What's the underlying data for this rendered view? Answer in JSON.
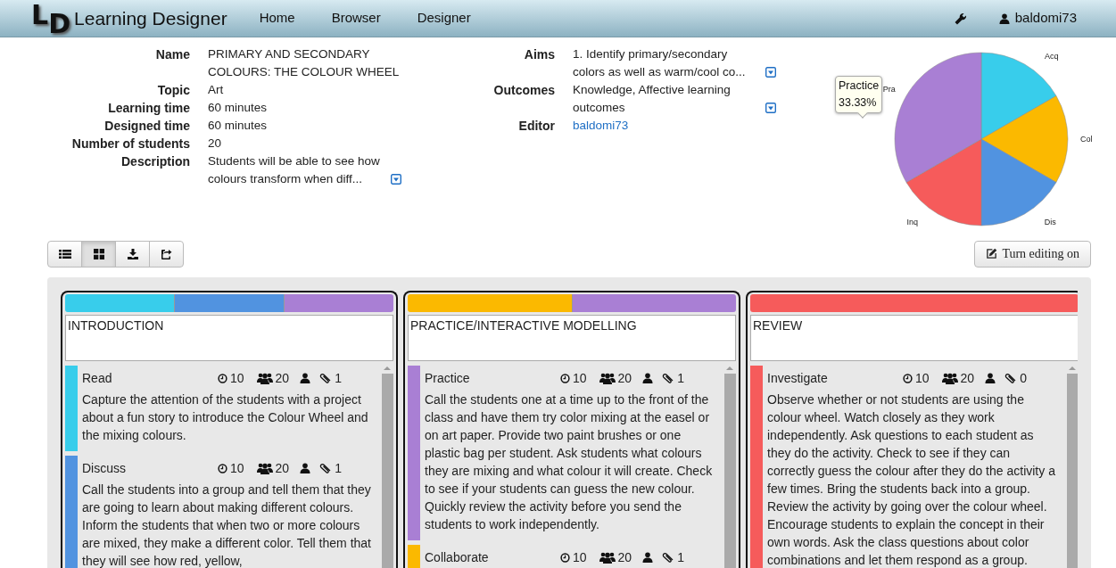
{
  "header": {
    "logo": [
      "L",
      "D"
    ],
    "title": "Learning Designer",
    "nav": [
      {
        "label": "Home"
      },
      {
        "label": "Browser"
      },
      {
        "label": "Designer"
      }
    ],
    "user": "baldomi73"
  },
  "details": {
    "left": [
      {
        "label": "Name",
        "value": "PRIMARY AND SECONDARY COLOURS: THE COLOUR WHEEL",
        "kind": "text",
        "truncated": false
      },
      {
        "label": "Topic",
        "value": "Art",
        "kind": "text",
        "truncated": false
      },
      {
        "label": "Learning time",
        "value": "60 minutes",
        "kind": "text",
        "truncated": false
      },
      {
        "label": "Designed time",
        "value": "60 minutes",
        "kind": "text",
        "truncated": false
      },
      {
        "label": "Number of students",
        "value": "20",
        "kind": "text",
        "truncated": false
      },
      {
        "label": "Description",
        "value": "Students will be able to see how colours transform when diff...",
        "kind": "text",
        "truncated": true
      }
    ],
    "right": [
      {
        "label": "Aims",
        "value": "1. Identify primary/secondary colors as well as warm/cool co...",
        "kind": "text",
        "truncated": true
      },
      {
        "label": "Outcomes",
        "value": "Knowledge, Affective learning outcomes",
        "kind": "text",
        "truncated": true
      },
      {
        "label": "Editor",
        "value": "baldomi73",
        "kind": "link",
        "truncated": false
      }
    ]
  },
  "pie": {
    "chart_data": {
      "type": "pie",
      "categories": [
        "Acq",
        "Col",
        "Dis",
        "Inq",
        "Pra"
      ],
      "values": [
        16.67,
        16.67,
        16.67,
        16.67,
        33.33
      ],
      "colors": [
        "#38cdeb",
        "#fbb900",
        "#5193e0",
        "#f65b5b",
        "#a97fd4"
      ]
    },
    "tooltip": {
      "label": "Practice",
      "value": "33.33%"
    }
  },
  "toolbar": {
    "buttons": [
      {
        "kind": "list",
        "selected": false
      },
      {
        "kind": "grid",
        "selected": true
      },
      {
        "kind": "download",
        "selected": false
      },
      {
        "kind": "share",
        "selected": false
      }
    ],
    "edit_button": "Turn editing on"
  },
  "columns": [
    {
      "title": "INTRODUCTION",
      "segments": [
        {
          "color": "#38cdeb"
        },
        {
          "color": "#5193e0"
        },
        {
          "color": "#a97fd4"
        }
      ],
      "activities": [
        {
          "name": "Read",
          "color": "#38cdeb",
          "time": "10",
          "group": "20",
          "attachments": "1",
          "description": "Capture the attention of the students with a project about a fun story to introduce the Colour Wheel and the mixing colours."
        },
        {
          "name": "Discuss",
          "color": "#5193e0",
          "time": "10",
          "group": "20",
          "attachments": "1",
          "description": "Call the students into a group and tell them that they are going to learn about making different colours. Inform the students that when two or more colours are mixed, they make a different color. Tell them that they will see how red, yellow,"
        }
      ]
    },
    {
      "title": "PRACTICE/INTERACTIVE MODELLING",
      "segments": [
        {
          "color": "#fbb900"
        },
        {
          "color": "#a97fd4"
        }
      ],
      "activities": [
        {
          "name": "Practice",
          "color": "#a97fd4",
          "time": "10",
          "group": "20",
          "attachments": "1",
          "description": "Call the students one at a time up to the front of the class and have them try color mixing at the easel or on art paper. Provide two paint brushes or one plastic bag per student. Ask students what colours they are mixing and what colour it will create. Check to see if your students can guess the new colour. Quickly review the activity before you send the students to work independently."
        },
        {
          "name": "Collaborate",
          "color": "#fbb900",
          "time": "10",
          "group": "20",
          "attachments": "1"
        }
      ]
    },
    {
      "title": "REVIEW",
      "segments": [
        {
          "color": "#f65b5b"
        }
      ],
      "activities": [
        {
          "name": "Investigate",
          "color": "#f65b5b",
          "time": "10",
          "group": "20",
          "attachments": "0",
          "description": "Observe whether or not students are using the colour wheel. Watch closely as they work independently. Ask questions to each student as they do the activity. Check to see if they can correctly guess the colour after they do the activity a few times. Bring the students back into a group. Review the activity by going over the colour wheel. Encourage students to explain the concept in their own words. Ask the class questions about color combinations and let them respond as a group."
        }
      ]
    }
  ]
}
